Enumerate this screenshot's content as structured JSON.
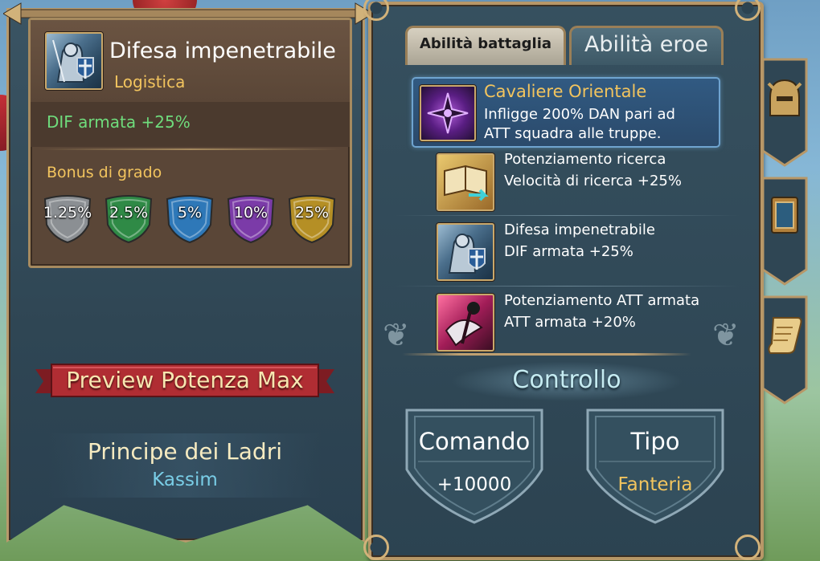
{
  "skill_detail": {
    "title": "Difesa impenetrabile",
    "category": "Logistica",
    "stat": "DIF armata +25%",
    "bonus_label": "Bonus di grado",
    "grade_bonuses": [
      {
        "value": "1.25%",
        "color": "#8b8f93"
      },
      {
        "value": "2.5%",
        "color": "#2f8a46"
      },
      {
        "value": "5%",
        "color": "#2e78b8"
      },
      {
        "value": "10%",
        "color": "#7b3ba8"
      },
      {
        "value": "25%",
        "color": "#b58f25"
      }
    ]
  },
  "preview_button": {
    "label": "Preview Potenza Max"
  },
  "hero": {
    "title": "Principe dei Ladri",
    "name": "Kassim"
  },
  "tabs": [
    {
      "label": "Abilità battaglia",
      "active": true
    },
    {
      "label": "Abilità eroe",
      "active": false
    }
  ],
  "main_skill": {
    "name": "Cavaliere Orientale",
    "description_line1": "Infligge 200% DAN pari ad",
    "description_line2": "ATT squadra alle truppe."
  },
  "skills": [
    {
      "name": "Potenziamento ricerca",
      "effect": "Velocità di ricerca +25%",
      "icon": "research-book-icon"
    },
    {
      "name": "Difesa impenetrabile",
      "effect": "DIF armata +25%",
      "icon": "knight-shield-icon"
    },
    {
      "name": "Potenziamento ATT armata",
      "effect": "ATT armata +20%",
      "icon": "axe-attack-icon"
    }
  ],
  "control": {
    "title": "Controllo",
    "command_label": "Comando",
    "command_value": "+10000",
    "type_label": "Tipo",
    "type_value": "Fanteria"
  },
  "colors": {
    "gold_text": "#f2c45e",
    "green_text": "#6fdc7c",
    "cyan_text": "#79cde6",
    "panel_border": "#b79767"
  }
}
